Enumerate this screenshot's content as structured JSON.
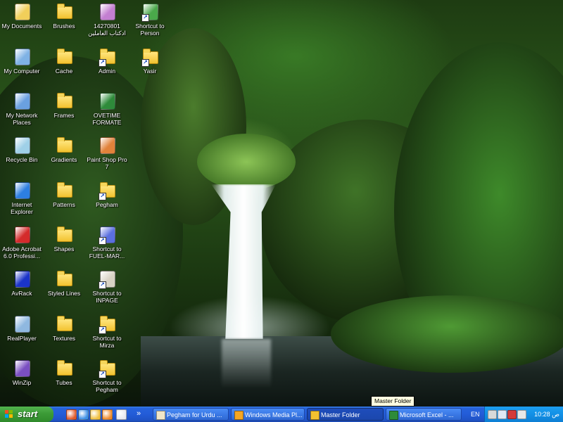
{
  "desktop_icons": [
    {
      "id": "my-documents",
      "label": "My Documents",
      "icon": "my-documents-icon",
      "kind": "generic",
      "color": "#f1cf5a",
      "col": 0,
      "row": 0
    },
    {
      "id": "my-computer",
      "label": "My Computer",
      "icon": "my-computer-icon",
      "kind": "generic",
      "color": "#7fb2e5",
      "col": 0,
      "row": 1
    },
    {
      "id": "my-network-places",
      "label": "My Network Places",
      "icon": "network-places-icon",
      "kind": "generic",
      "color": "#6aa0e0",
      "col": 0,
      "row": 2
    },
    {
      "id": "recycle-bin",
      "label": "Recycle Bin",
      "icon": "recycle-bin-icon",
      "kind": "generic",
      "color": "#9fd0e8",
      "col": 0,
      "row": 3
    },
    {
      "id": "internet-explorer",
      "label": "Internet Explorer",
      "icon": "internet-explorer-icon",
      "kind": "generic",
      "color": "#2d7fe0",
      "col": 0,
      "row": 4
    },
    {
      "id": "adobe-acrobat",
      "label": "Adobe Acrobat 6.0 Professi...",
      "icon": "adobe-acrobat-icon",
      "kind": "generic",
      "color": "#d42b2b",
      "col": 0,
      "row": 5
    },
    {
      "id": "avrack",
      "label": "AvRack",
      "icon": "avrack-icon",
      "kind": "generic",
      "color": "#1b34c9",
      "col": 0,
      "row": 6
    },
    {
      "id": "realplayer",
      "label": "RealPlayer",
      "icon": "realplayer-icon",
      "kind": "generic",
      "color": "#8fb8e0",
      "col": 0,
      "row": 7
    },
    {
      "id": "winzip",
      "label": "WinZip",
      "icon": "winzip-icon",
      "kind": "generic",
      "color": "#7a4fc2",
      "col": 0,
      "row": 8
    },
    {
      "id": "brushes",
      "label": "Brushes",
      "icon": "folder-icon",
      "kind": "folder",
      "col": 1,
      "row": 0
    },
    {
      "id": "cache",
      "label": "Cache",
      "icon": "folder-icon",
      "kind": "folder",
      "col": 1,
      "row": 1
    },
    {
      "id": "frames",
      "label": "Frames",
      "icon": "folder-icon",
      "kind": "folder",
      "col": 1,
      "row": 2
    },
    {
      "id": "gradients",
      "label": "Gradients",
      "icon": "folder-icon",
      "kind": "folder",
      "col": 1,
      "row": 3
    },
    {
      "id": "patterns",
      "label": "Patterns",
      "icon": "folder-icon",
      "kind": "folder",
      "col": 1,
      "row": 4
    },
    {
      "id": "shapes",
      "label": "Shapes",
      "icon": "folder-icon",
      "kind": "folder",
      "col": 1,
      "row": 5
    },
    {
      "id": "styled-lines",
      "label": "Styled Lines",
      "icon": "folder-icon",
      "kind": "folder",
      "col": 1,
      "row": 6
    },
    {
      "id": "textures",
      "label": "Textures",
      "icon": "folder-icon",
      "kind": "folder",
      "col": 1,
      "row": 7
    },
    {
      "id": "tubes",
      "label": "Tubes",
      "icon": "folder-icon",
      "kind": "folder",
      "col": 1,
      "row": 8
    },
    {
      "id": "arabic-file",
      "label": "14270801 ادکتاب العاملين",
      "icon": "archive-file-icon",
      "kind": "generic",
      "color": "#c37fd1",
      "col": 2,
      "row": 0
    },
    {
      "id": "admin",
      "label": "Admin",
      "icon": "folder-shortcut-icon",
      "kind": "folder",
      "shortcut": true,
      "col": 2,
      "row": 1
    },
    {
      "id": "overtime-formate",
      "label": "OVETIME FORMATE",
      "icon": "excel-file-icon",
      "kind": "generic",
      "color": "#2e8b3a",
      "col": 2,
      "row": 2
    },
    {
      "id": "paint-shop-pro",
      "label": "Paint Shop Pro 7",
      "icon": "paint-shop-pro-icon",
      "kind": "generic",
      "color": "#e1823a",
      "col": 2,
      "row": 3
    },
    {
      "id": "pegham",
      "label": "Pegham",
      "icon": "folder-shortcut-icon",
      "kind": "folder",
      "shortcut": true,
      "col": 2,
      "row": 4
    },
    {
      "id": "fuel-mar",
      "label": "Shortcut to FUEL-MAR...",
      "icon": "fuel-mar-shortcut-icon",
      "kind": "generic",
      "color": "#5a6fe0",
      "shortcut": true,
      "col": 2,
      "row": 5
    },
    {
      "id": "inpage",
      "label": "Shortcut to INPAGE",
      "icon": "inpage-shortcut-icon",
      "kind": "generic",
      "color": "#d8d2c4",
      "shortcut": true,
      "col": 2,
      "row": 6
    },
    {
      "id": "mirza",
      "label": "Shortcut to Mirza",
      "icon": "folder-shortcut-icon",
      "kind": "folder",
      "shortcut": true,
      "col": 2,
      "row": 7
    },
    {
      "id": "pegham-shortcut",
      "label": "Shortcut to Pegham",
      "icon": "folder-shortcut-icon",
      "kind": "folder",
      "shortcut": true,
      "col": 2,
      "row": 8
    },
    {
      "id": "person",
      "label": "Shortcut to Person",
      "icon": "person-shortcut-icon",
      "kind": "generic",
      "color": "#4aa84a",
      "shortcut": true,
      "col": 3,
      "row": 0
    },
    {
      "id": "yasir",
      "label": "Yasir",
      "icon": "folder-shortcut-icon",
      "kind": "folder",
      "shortcut": true,
      "col": 3,
      "row": 1
    }
  ],
  "taskbar": {
    "start_label": "start",
    "quick_launch": [
      {
        "name": "ql-firefox-icon",
        "color": "#e05a2b"
      },
      {
        "name": "ql-internet-explorer-icon",
        "color": "#3d8fe6"
      },
      {
        "name": "ql-outlook-icon",
        "color": "#f0c040"
      },
      {
        "name": "ql-media-player-icon",
        "color": "#f08a2a"
      },
      {
        "name": "ql-notepad-icon",
        "color": "#e8e8f0"
      }
    ],
    "overflow_label": "»",
    "tasks": [
      {
        "id": "pegham-urdu",
        "label": "Pegham for Urdu ...",
        "icon": "inpage-app-icon",
        "color": "#f0e6c8",
        "active": false
      },
      {
        "id": "media-player",
        "label": "Windows Media Pl...",
        "icon": "media-player-icon",
        "color": "#f5a623",
        "active": false
      },
      {
        "id": "master-folder",
        "label": "Master Folder",
        "icon": "folder-icon",
        "color": "#f2c230",
        "active": true
      },
      {
        "id": "excel",
        "label": "Microsoft Excel - ...",
        "icon": "excel-icon",
        "color": "#2e8b3a",
        "active": false
      }
    ],
    "language": "EN",
    "tray_icons": [
      {
        "name": "tray-keyboard-icon",
        "color": "#d9d9d9"
      },
      {
        "name": "tray-network-icon",
        "color": "#dfe7f5"
      },
      {
        "name": "tray-shield-icon",
        "color": "#d43a3a"
      },
      {
        "name": "tray-volume-icon",
        "color": "#e8e8e8"
      }
    ],
    "clock": "10:28 ص"
  },
  "tooltip": "Master Folder"
}
